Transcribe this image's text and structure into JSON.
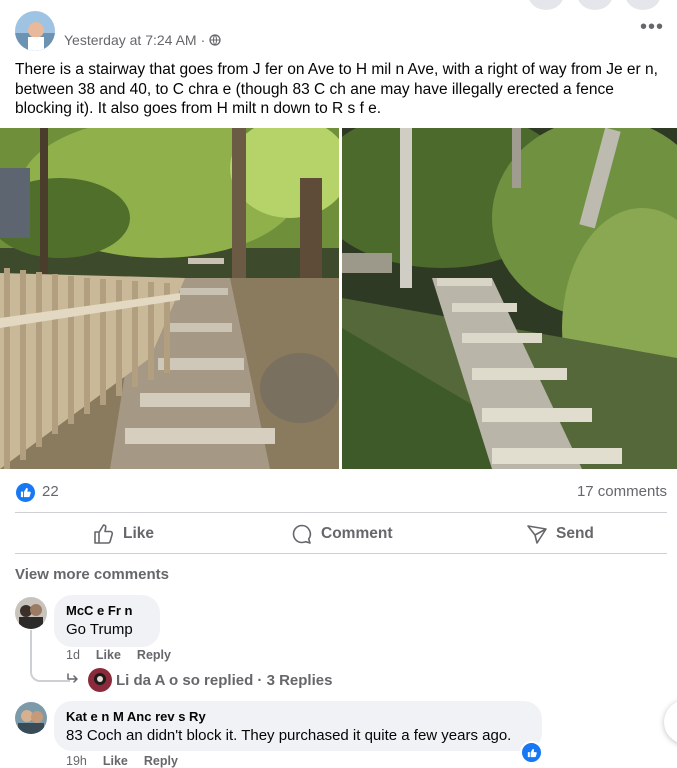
{
  "post": {
    "timestamp": "Yesterday at 7:24 AM",
    "separator": "·",
    "privacy_icon": "globe-icon",
    "more_icon": "ellipsis-icon",
    "text": "There is a stairway that goes from J   fer   on Ave to H   mil   n Ave, with a right of way from Je   er   n, between 38 and 40, to C   chra   e (though 83 C   ch   ane may have illegally erected a fence blocking it). It also goes from H   milt   n down to R   s   f   e.",
    "reactions_count": "22",
    "comments_count": "17 comments"
  },
  "actions": {
    "like": "Like",
    "comment": "Comment",
    "send": "Send"
  },
  "comments": {
    "view_more": "View more comments",
    "items": [
      {
        "author": "McC   e Fr   n",
        "text": "Go Trump",
        "time": "1d",
        "like": "Like",
        "reply": "Reply",
        "replies_summary": "Li   da A   o   so replied · 3 Replies"
      },
      {
        "author": "Kat   e   n M   Anc   rev   s Ry   ",
        "text": "83 Coch   an didn't block it. They purchased it quite a few years ago.",
        "time": "19h",
        "like": "Like",
        "reply": "Reply"
      }
    ]
  },
  "colors": {
    "accent": "#1877f2",
    "muted_text": "#65676b",
    "bubble_bg": "#f0f2f5",
    "divider": "#ced0d4"
  }
}
